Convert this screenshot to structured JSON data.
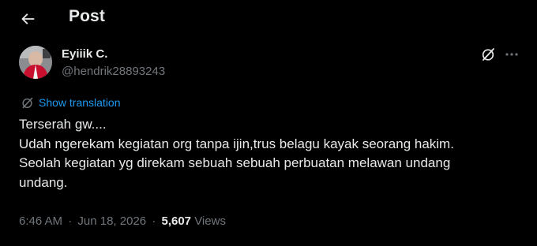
{
  "header": {
    "title": "Post"
  },
  "author": {
    "name": "Eyiiik C.",
    "handle": "@hendrik28893243"
  },
  "translation": {
    "label": "Show translation"
  },
  "tweet": {
    "lines": [
      "Terserah gw....",
      "Udah ngerekam kegiatan org tanpa ijin,trus belagu kayak seorang hakim.",
      "Seolah kegiatan yg direkam sebuah sebuah perbuatan melawan undang",
      "undang."
    ]
  },
  "meta": {
    "time": "6:46 AM",
    "separator": "·",
    "date": "Jun 18, 2026",
    "views_count": "5,607",
    "views_label": "Views"
  },
  "icons": {
    "back": "arrow-left-icon",
    "grok": "grok-icon",
    "more": "more-horizontal-icon",
    "translate": "translate-icon"
  },
  "colors": {
    "background": "#000000",
    "text": "#e7e9ea",
    "muted": "#71767b",
    "link": "#1d9bf0"
  }
}
